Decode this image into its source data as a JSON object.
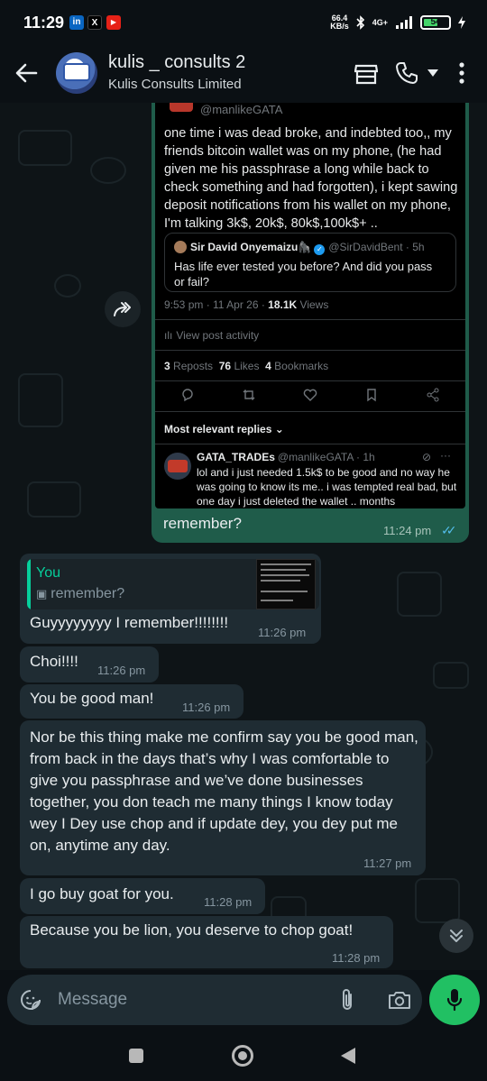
{
  "status_bar": {
    "time": "11:29",
    "apps": [
      "in",
      "X",
      "▶"
    ],
    "net_speed_value": "66.4",
    "net_speed_unit": "KB/s",
    "network": "4G+",
    "battery": "54"
  },
  "header": {
    "title": "kulis _ consults 2",
    "subtitle": "Kulis Consults Limited"
  },
  "tweet": {
    "author_handle": "@manlikeGATA",
    "body": "one time i was dead broke, and indebted too,, my friends bitcoin wallet was on my phone, (he had given me his passphrase a long while back to check something and had forgotten), i kept sawing deposit notifications from his wallet on my phone, I'm talking 3k$, 20k$, 80k$,100k$+ ..",
    "quote": {
      "name": "Sir David Onyemaizu🦍",
      "handle": "@SirDavidBent · 5h",
      "text": "Has life ever tested you before? And did you pass or fail?"
    },
    "meta_time": "9:53 pm · 11 Apr 26 · ",
    "meta_views_count": "18.1K",
    "meta_views_label": " Views",
    "activity": "View post activity",
    "reposts_count": "3",
    "reposts_label": "Reposts",
    "likes_count": "76",
    "likes_label": "Likes",
    "bookmarks_count": "4",
    "bookmarks_label": "Bookmarks",
    "replies_sort": "Most relevant replies ⌄",
    "reply": {
      "name": "GATA_TRADEs",
      "handle": "@manlikeGATA · 1h",
      "text": "lol and i just needed 1.5k$ to be good and no way he was going to know its me.. i was tempted real bad, but one day i just deleted the wallet .. months"
    }
  },
  "outgoing": {
    "caption": "remember?",
    "time": "11:24 pm"
  },
  "reply_preview": {
    "name": "You",
    "text": "remember?"
  },
  "messages": [
    {
      "text": "Guyyyyyyyy I remember!!!!!!!!",
      "time": "11:26 pm"
    },
    {
      "text": "Choi!!!!",
      "time": "11:26 pm"
    },
    {
      "text": "You be good man!",
      "time": "11:26 pm"
    },
    {
      "text": "Nor be this thing make me confirm say you be good man, from back in the days that’s why I was comfortable to give you passphrase and we’ve done businesses together, you don teach me many things I know today wey I Dey use chop and if update dey, you dey put me on, anytime any day.",
      "time": "11:27 pm"
    },
    {
      "text": "I go buy goat for you.",
      "time": "11:28 pm"
    },
    {
      "text": "Because you be lion, you deserve to chop goat!",
      "time": "11:28 pm"
    }
  ],
  "composer": {
    "placeholder": "Message"
  },
  "colors": {
    "outgoing_bubble": "#1f5c4a",
    "incoming_bubble": "#1f2c33",
    "accent_green": "#21c063",
    "read_ticks": "#53bdeb"
  }
}
